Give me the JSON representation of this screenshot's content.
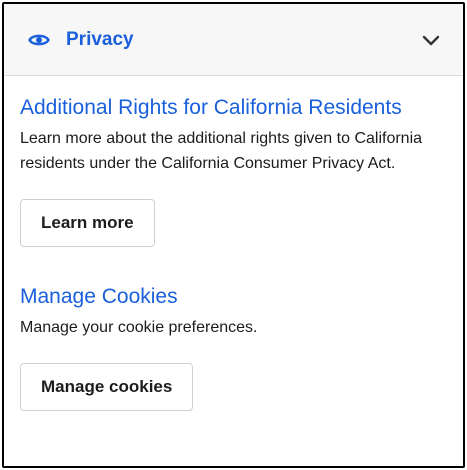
{
  "section": {
    "title": "Privacy",
    "icon": "eye-icon",
    "toggle_icon": "chevron-down-icon",
    "accent_color": "#1a5fdb"
  },
  "california": {
    "heading": "Additional Rights for California Residents",
    "description": "Learn more about the additional rights given to California residents under the California Consumer Privacy Act.",
    "button_label": "Learn more"
  },
  "cookies": {
    "heading": "Manage Cookies",
    "description": "Manage your cookie preferences.",
    "button_label": "Manage cookies"
  }
}
